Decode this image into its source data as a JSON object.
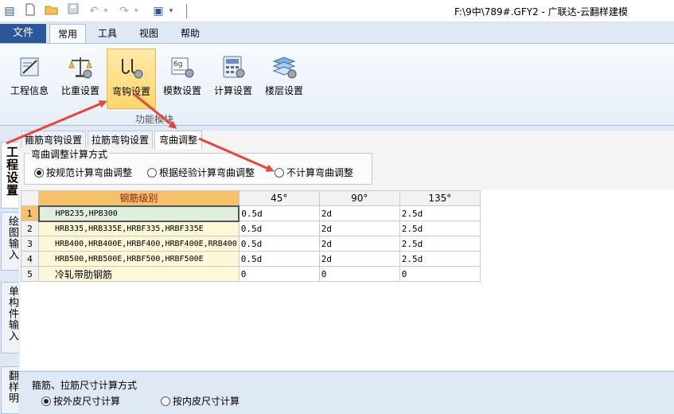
{
  "titlebar": {
    "title": "F:\\9中\\789#.GFY2 - 广联达-云翻样建模"
  },
  "ribbon": {
    "file_tab": "文件",
    "tabs": [
      "常用",
      "工具",
      "视图",
      "帮助"
    ],
    "buttons": [
      {
        "label": "工程信息",
        "icon": "project-info-icon"
      },
      {
        "label": "比重设置",
        "icon": "scale-icon"
      },
      {
        "label": "弯钩设置",
        "icon": "hook-settings-icon"
      },
      {
        "label": "模数设置",
        "icon": "modulus-icon"
      },
      {
        "label": "计算设置",
        "icon": "calculator-icon"
      },
      {
        "label": "楼层设置",
        "icon": "floors-icon"
      }
    ],
    "group_label": "功能模块"
  },
  "left_tabs": [
    "工程设置",
    "绘图输入",
    "单构件输入",
    "翻样明"
  ],
  "sub_tabs": [
    "箍筋弯钩设置",
    "拉筋弯钩设置",
    "弯曲调整"
  ],
  "bend_adjust": {
    "legend": "弯曲调整计算方式",
    "options": [
      "按规范计算弯曲调整",
      "根据经验计算弯曲调整",
      "不计算弯曲调整"
    ]
  },
  "table": {
    "headers": [
      "钢筋级别",
      "45°",
      "90°",
      "135°"
    ],
    "rows": [
      {
        "num": "1",
        "grade": "HPB235,HPB300",
        "v45": "0.5d",
        "v90": "2d",
        "v135": "2.5d"
      },
      {
        "num": "2",
        "grade": "HRB335,HRB335E,HRBF335,HRBF335E",
        "v45": "0.5d",
        "v90": "2d",
        "v135": "2.5d"
      },
      {
        "num": "3",
        "grade": "HRB400,HRB400E,HRBF400,HRBF400E,RRB400",
        "v45": "0.5d",
        "v90": "2d",
        "v135": "2.5d"
      },
      {
        "num": "4",
        "grade": "HRB500,HRB500E,HRBF500,HRBF500E",
        "v45": "0.5d",
        "v90": "2d",
        "v135": "2.5d"
      },
      {
        "num": "5",
        "grade": "冷轧带肋钢筋",
        "v45": "0",
        "v90": "0",
        "v135": "0"
      }
    ]
  },
  "bottom": {
    "title": "箍筋、拉筋尺寸计算方式",
    "options": [
      "按外皮尺寸计算",
      "按内皮尺寸计算"
    ]
  },
  "colors": {
    "accent": "#2b579a",
    "selected_button": "#ffd66b",
    "grade_header": "#f5c26b",
    "arrow": "#e8453c"
  }
}
